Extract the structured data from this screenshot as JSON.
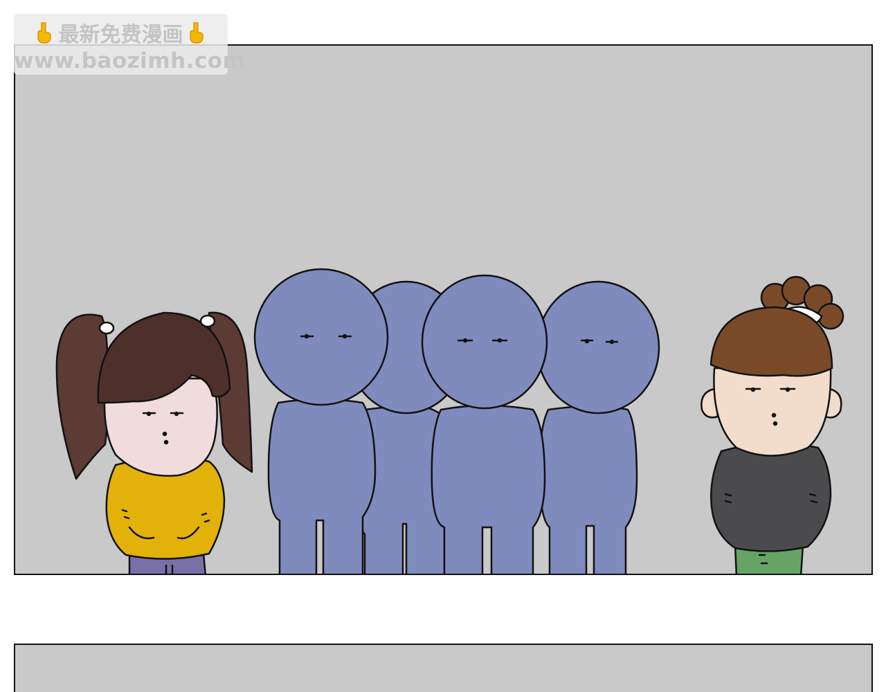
{
  "watermark": {
    "title": "最新免费漫画",
    "url": "www.baozimh.com",
    "icon": "pointing-down-hand-icon"
  },
  "panels": [
    {
      "description_colors": {
        "background": "#c9c9c9",
        "crowd": "#7f8bbd",
        "girl_sweater": "#e3b20a",
        "boy_sweater": "#4b4b4d",
        "boy_pants": "#66a466"
      },
      "characters": [
        "girl-with-pigtails",
        "blue-crowd",
        "boy-with-bun"
      ]
    },
    {
      "description_colors": {
        "background": "#c9c9c9"
      }
    }
  ]
}
